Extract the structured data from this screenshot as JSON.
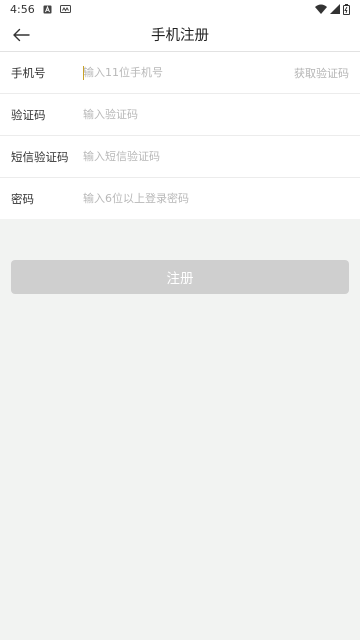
{
  "status_bar": {
    "time": "4:56",
    "icons": [
      "notification-a-icon",
      "notification-bars-icon",
      "wifi-icon",
      "cell-signal-icon",
      "battery-icon"
    ]
  },
  "header": {
    "title": "手机注册",
    "back_icon": "arrow-left-icon"
  },
  "form": {
    "phone": {
      "label": "手机号",
      "placeholder": "输入11位手机号",
      "value": "",
      "action_label": "获取验证码"
    },
    "captcha": {
      "label": "验证码",
      "placeholder": "输入验证码",
      "value": ""
    },
    "sms_code": {
      "label": "短信验证码",
      "placeholder": "输入短信验证码",
      "value": ""
    },
    "password": {
      "label": "密码",
      "placeholder": "输入6位以上登录密码",
      "value": ""
    }
  },
  "submit": {
    "label": "注册"
  },
  "colors": {
    "background": "#f2f3f2",
    "button_disabled": "#cfcfcf",
    "placeholder": "#b8b8b8",
    "cursor": "#c9a227"
  }
}
